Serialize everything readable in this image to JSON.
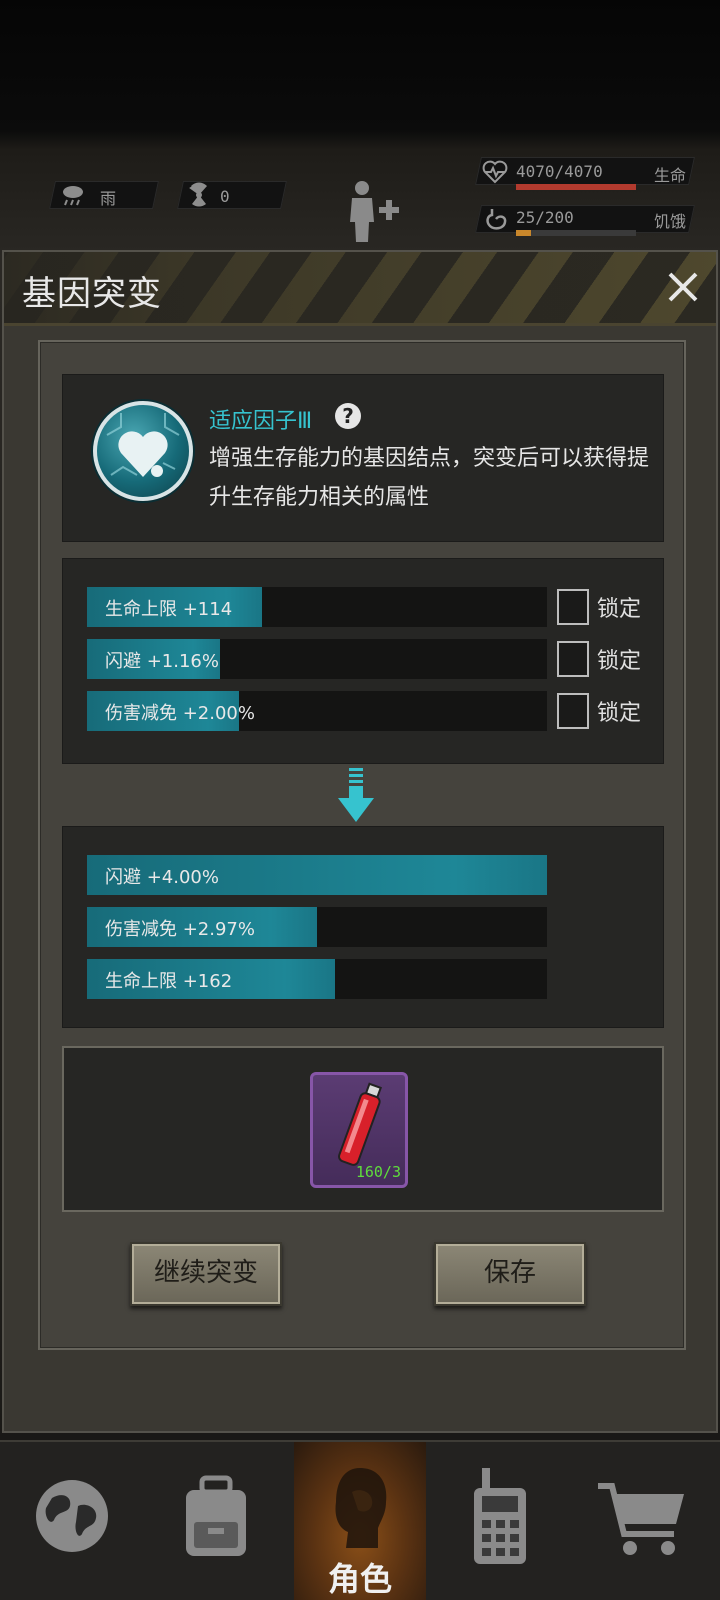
{
  "hud": {
    "weather": {
      "icon": "rain-cloud-icon",
      "label": "雨"
    },
    "radiation": {
      "icon": "radiation-icon",
      "value": "0"
    },
    "character_icon": "body-plus-icon",
    "health": {
      "icon": "heart-pulse-icon",
      "value": "4070/4070",
      "label": "生命",
      "fraction": 1.0,
      "color": "#b23a2e"
    },
    "hunger": {
      "icon": "stomach-icon",
      "value": "25/200",
      "label": "饥饿",
      "fraction": 0.125,
      "color": "#c9872b"
    }
  },
  "dialog": {
    "title": "基因突变",
    "close_icon": "close-icon",
    "gene": {
      "icon": "gene-heart-icon",
      "name": "适应因子Ⅲ",
      "help_icon": "help-icon",
      "description": "增强生存能力的基因结点，突变后可以获得提升生存能力相关的属性"
    },
    "current_stats": [
      {
        "text": "生命上限 +114",
        "fill": 0.38,
        "lock_label": "锁定",
        "locked": false
      },
      {
        "text": "闪避 +1.16%",
        "fill": 0.29,
        "lock_label": "锁定",
        "locked": false
      },
      {
        "text": "伤害减免 +2.00%",
        "fill": 0.33,
        "lock_label": "锁定",
        "locked": false
      }
    ],
    "arrow_icon": "arrow-down-icon",
    "new_stats": [
      {
        "text": "闪避 +4.00%",
        "fill": 1.0
      },
      {
        "text": "伤害减免 +2.97%",
        "fill": 0.5
      },
      {
        "text": "生命上限 +162",
        "fill": 0.54
      }
    ],
    "cost_item": {
      "icon": "serum-vial-icon",
      "count": "160/3"
    },
    "buttons": {
      "continue": "继续突变",
      "save": "保存"
    }
  },
  "nav": {
    "items": [
      {
        "icon": "globe-icon",
        "label": ""
      },
      {
        "icon": "backpack-icon",
        "label": ""
      },
      {
        "icon": "character-head-icon",
        "label": "角色",
        "active": true
      },
      {
        "icon": "walkie-talkie-icon",
        "label": ""
      },
      {
        "icon": "cart-icon",
        "label": ""
      }
    ]
  },
  "colors": {
    "accent": "#36c3cf",
    "bar": "#1e8797",
    "item_bg": "#5b3c73"
  }
}
